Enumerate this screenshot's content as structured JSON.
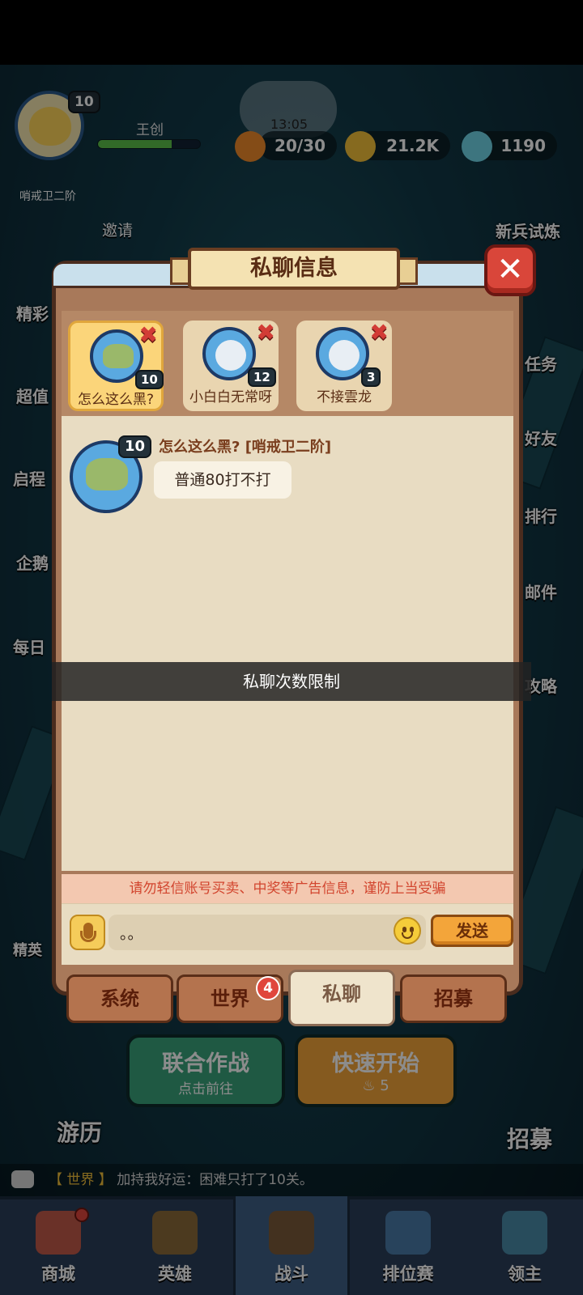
{
  "hud": {
    "player_level": "10",
    "player_name": "王创",
    "xp_progress": 0.72,
    "rank_title": "哨戒卫二阶",
    "invite_label": "邀请",
    "stamina_timer": "13:05",
    "stamina": "20/30",
    "gold": "21.2K",
    "gems": "1190",
    "recruit_training": "新兵试炼"
  },
  "side_menu": {
    "left": [
      "精彩",
      "超值",
      "启程",
      "企鹅",
      "每日"
    ],
    "right": [
      "任务",
      "好友",
      "排行",
      "邮件",
      "攻略"
    ],
    "elite_label": "精英"
  },
  "bottom_area": {
    "coop_title": "联合作战",
    "coop_sub": "点击前往",
    "quick_start_title": "快速开始",
    "quick_start_cost": "5",
    "travel_label": "游历",
    "recruit_label": "招募",
    "world_chat_channel": "【 世界 】",
    "world_chat_text": "加持我好运：困难只打了10关。"
  },
  "navbar": {
    "items": [
      {
        "label": "商城"
      },
      {
        "label": "英雄"
      },
      {
        "label": "战斗"
      },
      {
        "label": "排位赛"
      },
      {
        "label": "领主"
      }
    ]
  },
  "dialog": {
    "title": "私聊信息",
    "close_symbol": "✕",
    "contacts": [
      {
        "name": "怎么这么黑?",
        "level": "10",
        "active": true
      },
      {
        "name": "小白白无常呀",
        "level": "12",
        "active": false
      },
      {
        "name": "不接雲龙",
        "level": "3",
        "active": false
      }
    ],
    "messages": [
      {
        "sender": "怎么这么黑?  [哨戒卫二阶]",
        "level": "10",
        "text": "普通80打不打"
      }
    ],
    "toast": "私聊次数限制",
    "warning": "请勿轻信账号买卖、中奖等广告信息，谨防上当受骗",
    "input_value": "。。",
    "send_label": "发送",
    "tabs": [
      {
        "label": "系统"
      },
      {
        "label": "世界",
        "badge": "4"
      },
      {
        "label": "私聊",
        "active": true
      },
      {
        "label": "招募"
      }
    ]
  },
  "colors": {
    "dialog_bg": "#a8795a",
    "tab_active": "#efe4cc",
    "send_btn": "#f3a53a",
    "close_btn": "#d9463a",
    "warning_text": "#d2452e"
  }
}
